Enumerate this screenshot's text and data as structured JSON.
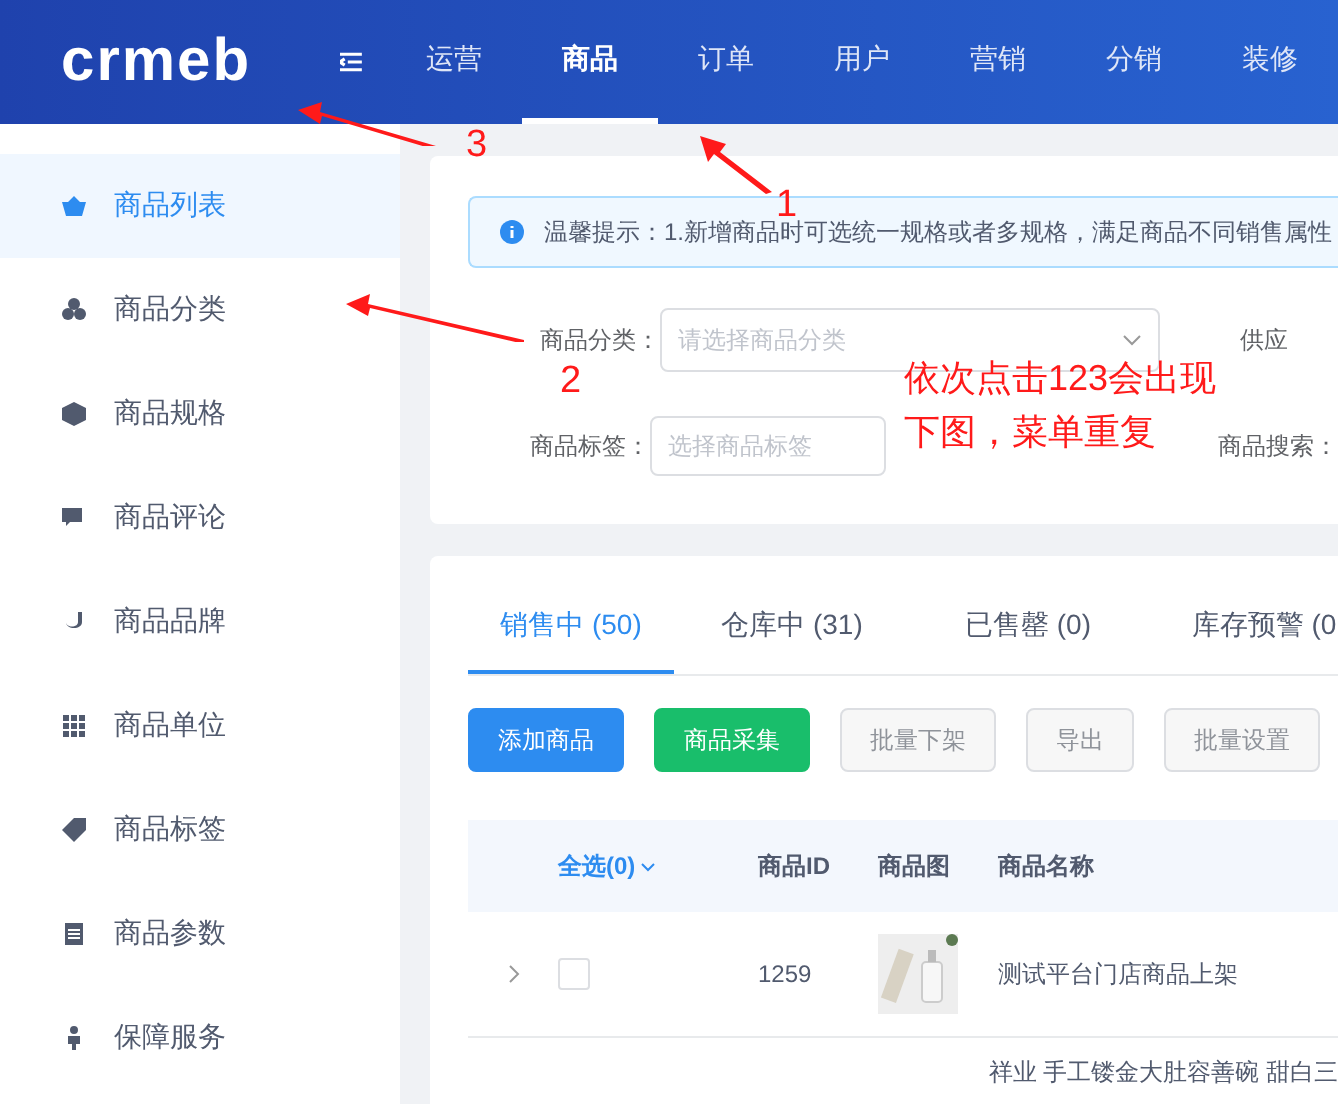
{
  "header": {
    "logo": "crmeb",
    "nav": [
      {
        "label": "运营",
        "selected": false
      },
      {
        "label": "商品",
        "selected": true
      },
      {
        "label": "订单",
        "selected": false
      },
      {
        "label": "用户",
        "selected": false
      },
      {
        "label": "营销",
        "selected": false
      },
      {
        "label": "分销",
        "selected": false
      },
      {
        "label": "装修",
        "selected": false
      }
    ]
  },
  "sidebar": {
    "items": [
      {
        "label": "商品列表",
        "selected": true
      },
      {
        "label": "商品分类",
        "selected": false
      },
      {
        "label": "商品规格",
        "selected": false
      },
      {
        "label": "商品评论",
        "selected": false
      },
      {
        "label": "商品品牌",
        "selected": false
      },
      {
        "label": "商品单位",
        "selected": false
      },
      {
        "label": "商品标签",
        "selected": false
      },
      {
        "label": "商品参数",
        "selected": false
      },
      {
        "label": "保障服务",
        "selected": false
      }
    ]
  },
  "alert": "温馨提示：1.新增商品时可选统一规格或者多规格，满足商品不同销售属性",
  "filters": {
    "category": {
      "label": "商品分类：",
      "placeholder": "请选择商品分类"
    },
    "supplier": {
      "label": "供应"
    },
    "tag": {
      "label": "商品标签：",
      "placeholder": "选择商品标签"
    },
    "search": {
      "label": "商品搜索："
    }
  },
  "tabs": [
    {
      "label": "销售中 (50)",
      "selected": true
    },
    {
      "label": "仓库中 (31)",
      "selected": false
    },
    {
      "label": "已售罄 (0)",
      "selected": false
    },
    {
      "label": "库存预警 (0",
      "selected": false
    }
  ],
  "buttons": [
    {
      "label": "添加商品",
      "kind": "primary"
    },
    {
      "label": "商品采集",
      "kind": "success"
    },
    {
      "label": "批量下架",
      "kind": "disabled"
    },
    {
      "label": "导出",
      "kind": "disabled"
    },
    {
      "label": "批量设置",
      "kind": "disabled"
    }
  ],
  "table": {
    "columns": [
      "全选(0)",
      "商品ID",
      "商品图",
      "商品名称"
    ],
    "rows": [
      {
        "id": "1259",
        "name": "测试平台门店商品上架",
        "checked": false
      },
      {
        "name": "祥业 手工镂金大肚容善碗 甜白三"
      }
    ]
  },
  "annotations": {
    "numbers": [
      "1",
      "2",
      "3"
    ],
    "note": [
      "依次点击123会出现",
      "下图，菜单重复"
    ]
  }
}
